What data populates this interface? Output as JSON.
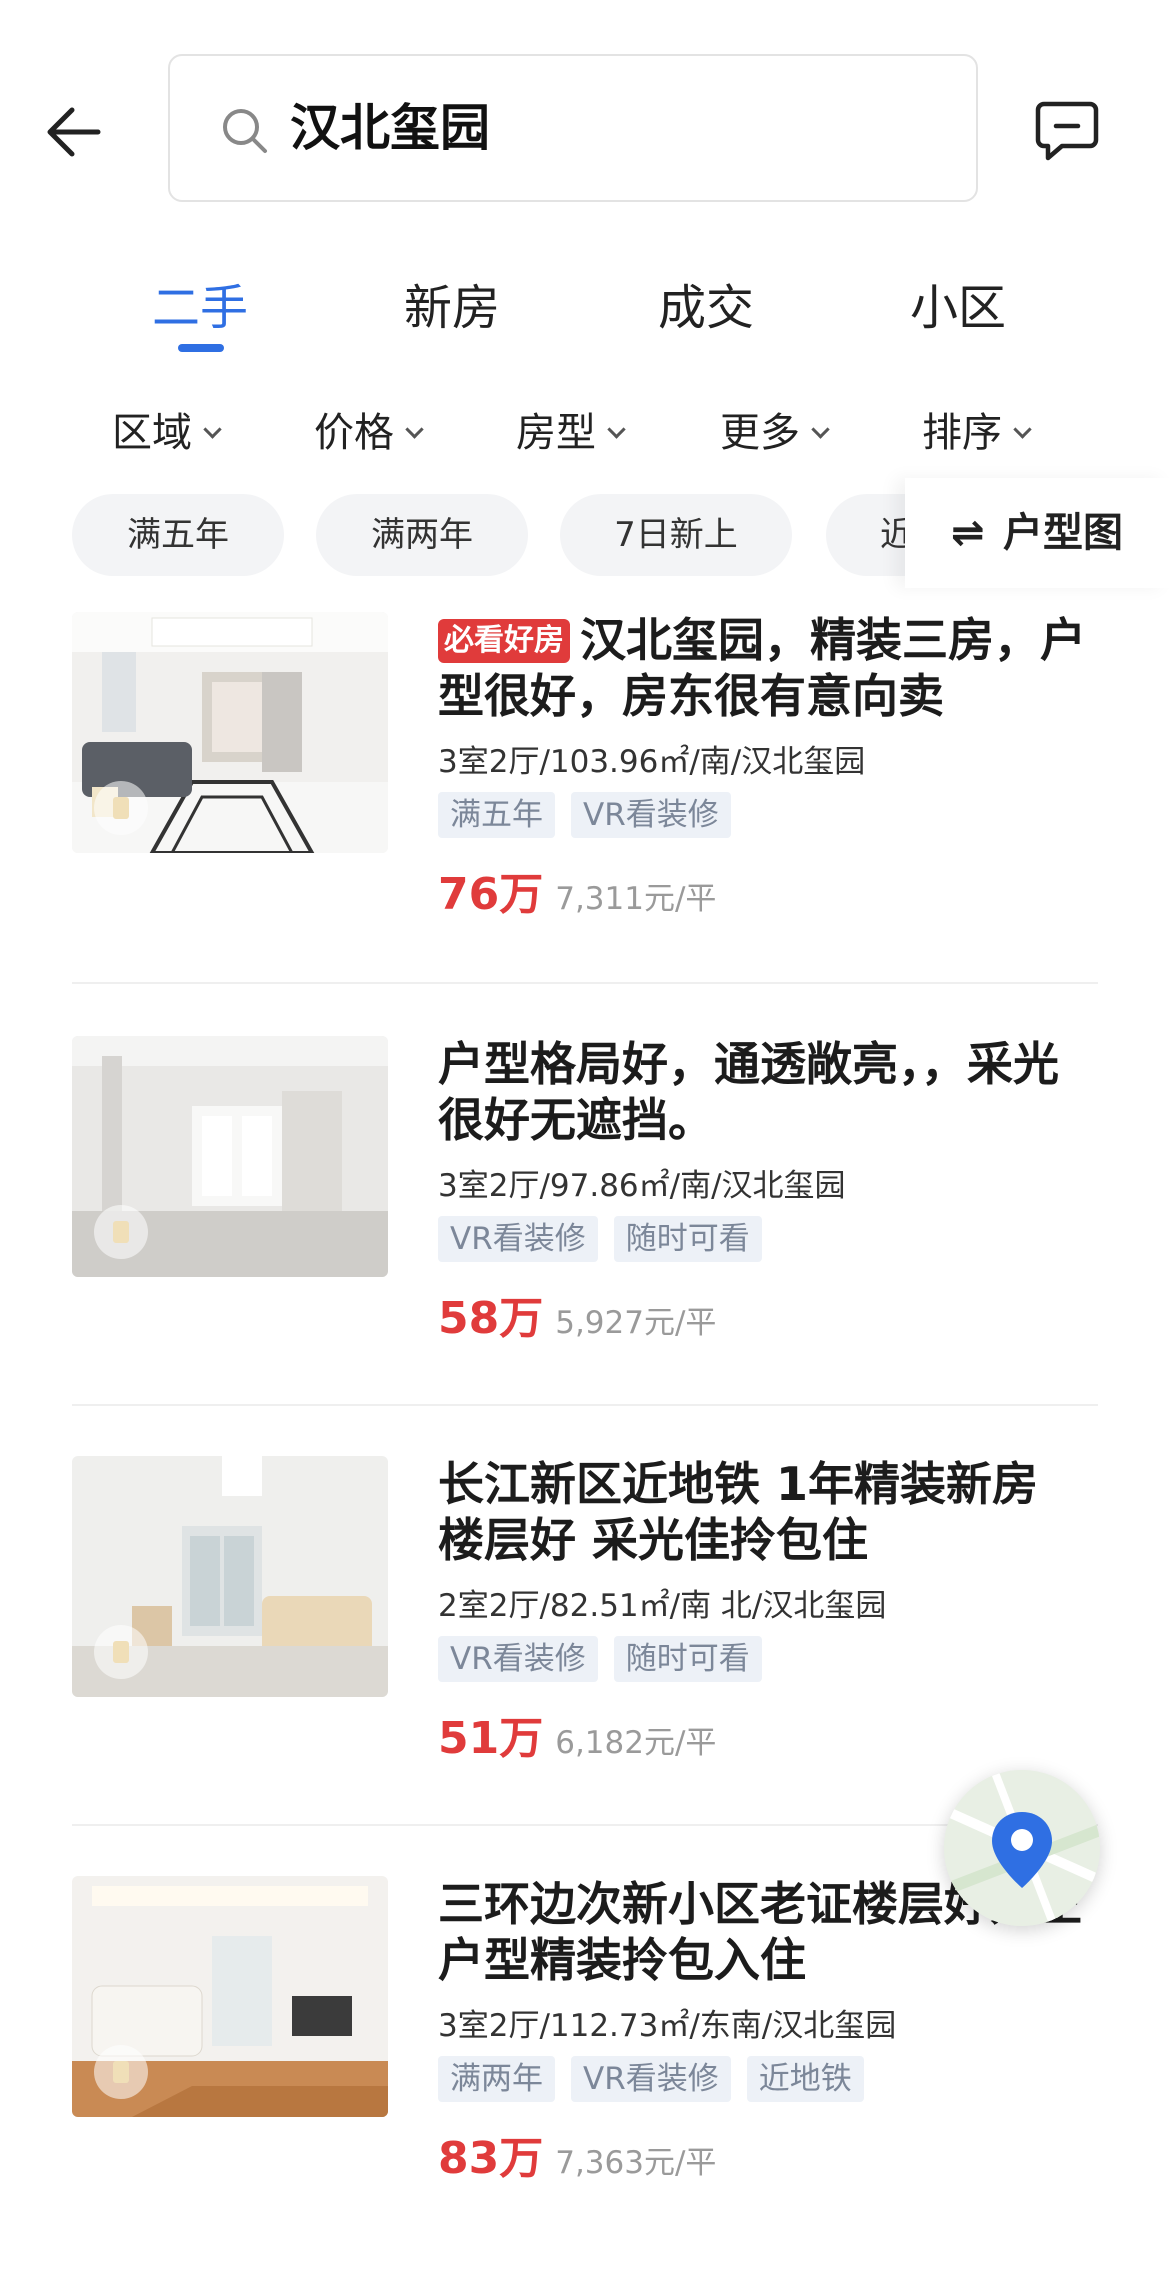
{
  "search": {
    "query": "汉北玺园"
  },
  "tabs": [
    {
      "label": "二手",
      "active": true
    },
    {
      "label": "新房",
      "active": false
    },
    {
      "label": "成交",
      "active": false
    },
    {
      "label": "小区",
      "active": false
    }
  ],
  "filters": [
    "区域",
    "价格",
    "房型",
    "更多",
    "排序"
  ],
  "chips": [
    "满五年",
    "满两年",
    "7日新上",
    "近"
  ],
  "huxing_label": "户型图",
  "listings": [
    {
      "badge": "必看好房",
      "title": "汉北玺园，精装三房，户型很好，房东很有意向卖",
      "meta": "3室2厅/103.96㎡/南/汉北玺园",
      "tags": [
        "满五年",
        "VR看装修"
      ],
      "price": "76万",
      "unit_price": "7,311元/平"
    },
    {
      "badge": "",
      "title": "户型格局好，通透敞亮，，采光很好无遮挡。",
      "meta": "3室2厅/97.86㎡/南/汉北玺园",
      "tags": [
        "VR看装修",
        "随时可看"
      ],
      "price": "58万",
      "unit_price": "5,927元/平"
    },
    {
      "badge": "",
      "title": "长江新区近地铁 1年精装新房 楼层好 采光佳拎包住",
      "meta": "2室2厅/82.51㎡/南 北/汉北玺园",
      "tags": [
        "VR看装修",
        "随时可看"
      ],
      "price": "51万",
      "unit_price": "6,182元/平"
    },
    {
      "badge": "",
      "title": "三环边次新小区老证楼层好方正户型精装拎包入住",
      "meta": "3室2厅/112.73㎡/东南/汉北玺园",
      "tags": [
        "满两年",
        "VR看装修",
        "近地铁"
      ],
      "price": "83万",
      "unit_price": "7,363元/平"
    }
  ],
  "colors": {
    "accent": "#2f6fe3",
    "price": "#e03b3b",
    "badge": "#e03b3b"
  },
  "icons": {
    "back": "arrow-left-icon",
    "search": "search-icon",
    "message": "message-icon",
    "map": "map-pin-icon"
  }
}
